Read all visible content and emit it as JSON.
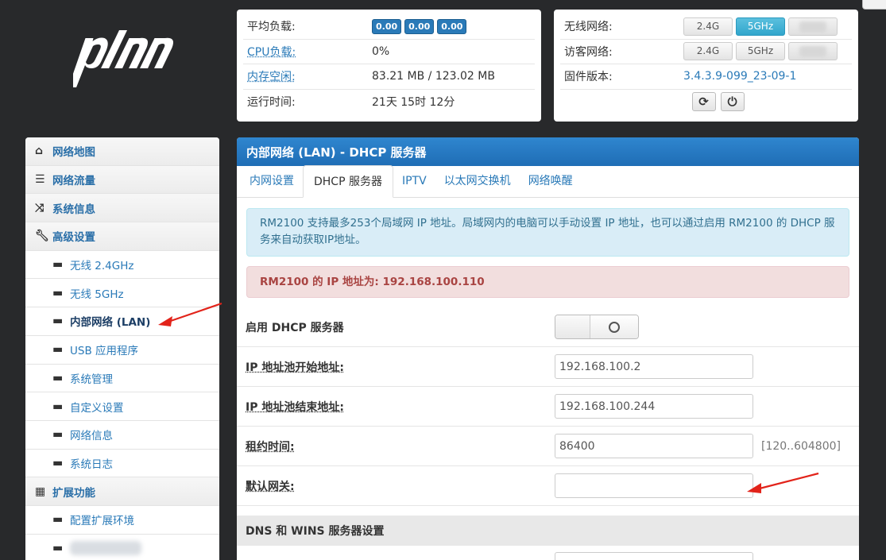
{
  "logo": {
    "text": "pdan"
  },
  "status_left": {
    "rows": [
      {
        "label": "平均负载:",
        "loads": [
          "0.00",
          "0.00",
          "0.00"
        ]
      },
      {
        "label": "CPU负载:",
        "value": "0%"
      },
      {
        "label": "内存空闲:",
        "value": "83.21 MB / 123.02 MB"
      },
      {
        "label": "运行时间:",
        "value": "21天 15时 12分"
      }
    ]
  },
  "status_right": {
    "wireless_label": "无线网络:",
    "guest_label": "访客网络:",
    "firmware_label": "固件版本:",
    "firmware_value": "3.4.3.9-099_23-09-1",
    "btn_24g": "2.4G",
    "btn_5g": "5GHz",
    "refresh_icon": "refresh-icon",
    "power_icon": "power-icon"
  },
  "sidebar": {
    "items": [
      {
        "label": "网络地图",
        "icon": "home-icon",
        "type": "top"
      },
      {
        "label": "网络流量",
        "icon": "storage-icon",
        "type": "top"
      },
      {
        "label": "系统信息",
        "icon": "shuffle-icon",
        "type": "top"
      },
      {
        "label": "高级设置",
        "icon": "wrench-icon",
        "type": "top"
      },
      {
        "label": "无线 2.4GHz",
        "type": "sub"
      },
      {
        "label": "无线 5GHz",
        "type": "sub"
      },
      {
        "label": "内部网络 (LAN)",
        "type": "sub"
      },
      {
        "label": "USB 应用程序",
        "type": "sub"
      },
      {
        "label": "系统管理",
        "type": "sub"
      },
      {
        "label": "自定义设置",
        "type": "sub"
      },
      {
        "label": "网络信息",
        "type": "sub"
      },
      {
        "label": "系统日志",
        "type": "sub"
      },
      {
        "label": "扩展功能",
        "icon": "grid-icon",
        "type": "top"
      },
      {
        "label": "配置扩展环境",
        "type": "sub"
      }
    ]
  },
  "main": {
    "title": "内部网络 (LAN) - DHCP 服务器",
    "tabs": [
      "内网设置",
      "DHCP 服务器",
      "IPTV",
      "以太网交换机",
      "网络唤醒"
    ],
    "info_text": "RM2100 支持最多253个局域网 IP 地址。局域网内的电脑可以手动设置 IP 地址，也可以通过启用 RM2100 的 DHCP 服务来自动获取IP地址。",
    "ip_text": "RM2100 的 IP 地址为: 192.168.100.110",
    "fields": {
      "dhcp_enable_label": "启用 DHCP 服务器",
      "pool_start_label": "IP 地址池开始地址:",
      "pool_start_value": "192.168.100.2",
      "pool_end_label": "IP 地址池结束地址:",
      "pool_end_value": "192.168.100.244",
      "lease_label": "租约时间:",
      "lease_value": "86400",
      "lease_hint": "[120..604800]",
      "gateway_label": "默认网关:",
      "gateway_value": ""
    },
    "dns_section": "DNS 和 WINS 服务器设置"
  }
}
